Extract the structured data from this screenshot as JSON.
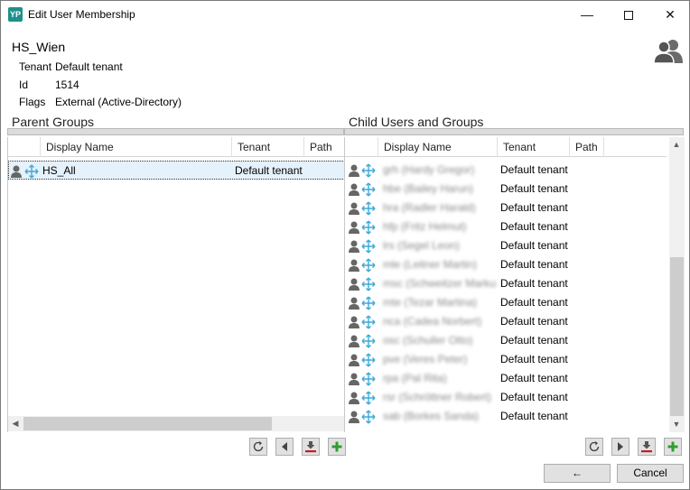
{
  "window": {
    "title": "Edit User Membership",
    "app_icon_text": "YP",
    "minimize_glyph": "—",
    "close_glyph": "✕"
  },
  "user": {
    "name": "HS_Wien",
    "tenant_label": "Tenant",
    "tenant_value": "Default tenant",
    "id_label": "Id",
    "id_value": "1514",
    "flags_label": "Flags",
    "flags_value": "External (Active-Directory)"
  },
  "parent_groups": {
    "title": "Parent Groups",
    "columns": [
      "Display Name",
      "Tenant",
      "Path"
    ],
    "rows": [
      {
        "name": "HS_All",
        "tenant": "Default tenant",
        "selected": true
      }
    ]
  },
  "child_groups": {
    "title": "Child Users and Groups",
    "columns": [
      "Display Name",
      "Tenant",
      "Path"
    ],
    "rows": [
      {
        "name": "grh (Hardy Gregor)",
        "tenant": "Default tenant"
      },
      {
        "name": "hbe (Bailey Harun)",
        "tenant": "Default tenant"
      },
      {
        "name": "hra (Radler Harald)",
        "tenant": "Default tenant"
      },
      {
        "name": "hfp (Fritz Helmut)",
        "tenant": "Default tenant"
      },
      {
        "name": "lrs (Segel Leon)",
        "tenant": "Default tenant"
      },
      {
        "name": "mle (Leitner Martin)",
        "tenant": "Default tenant"
      },
      {
        "name": "msc (Schweitzer Markus)",
        "tenant": "Default tenant"
      },
      {
        "name": "mte (Tezar Martina)",
        "tenant": "Default tenant"
      },
      {
        "name": "nca (Cadea Norbert)",
        "tenant": "Default tenant"
      },
      {
        "name": "osc (Schuller Otto)",
        "tenant": "Default tenant"
      },
      {
        "name": "pve (Veres Peter)",
        "tenant": "Default tenant"
      },
      {
        "name": "rpa (Pal Rita)",
        "tenant": "Default tenant"
      },
      {
        "name": "rsr (Schröttner Robert)",
        "tenant": "Default tenant"
      },
      {
        "name": "sab (Borkes Sanda)",
        "tenant": "Default tenant"
      }
    ]
  },
  "icons": {
    "user": "user-icon",
    "link": "link-icon",
    "refresh": "refresh-icon",
    "arrow_left": "arrow-left-icon",
    "arrow_right": "arrow-right-icon",
    "remove": "remove-icon",
    "add": "add-icon",
    "back": "back-arrow-icon"
  },
  "buttons": {
    "back_glyph": "←",
    "cancel": "Cancel"
  },
  "colors": {
    "accent": "#1e8f8b",
    "link_icon": "#3fa9d9",
    "add_green": "#2e9e2e",
    "remove_red": "#c42020",
    "selection": "#e5f1fb"
  }
}
